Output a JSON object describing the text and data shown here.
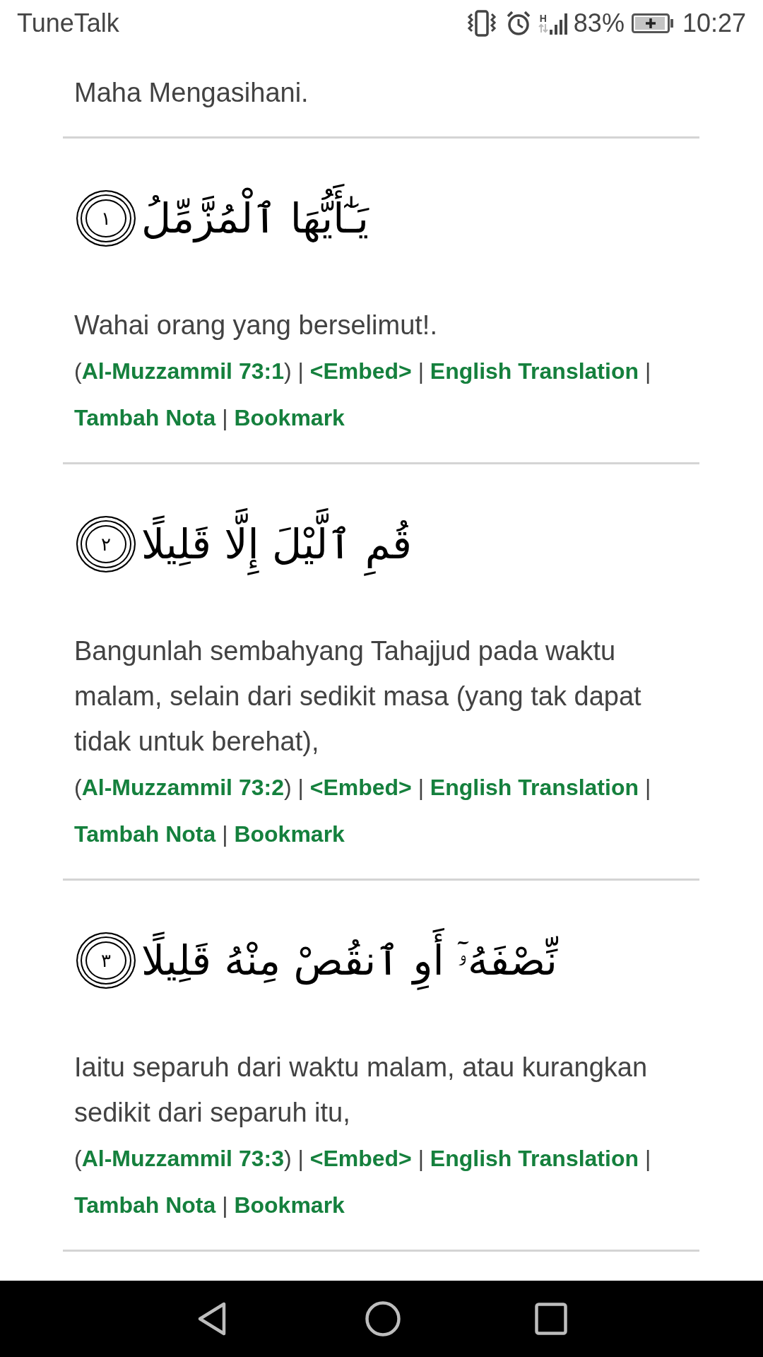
{
  "status_bar": {
    "carrier": "TuneTalk",
    "network_type": "H",
    "battery": "83%",
    "time": "10:27"
  },
  "intro": {
    "text": "Maha Mengasihani."
  },
  "verses": [
    {
      "arabic": "يَـٰٓأَيُّهَا ٱلْمُزَّمِّلُ",
      "number": "١",
      "translation": "Wahai orang yang berselimut!.",
      "reference_line": [
        {
          "kind": "open",
          "text": "("
        },
        {
          "kind": "link",
          "text": "Al-Muzzammil 73:1"
        },
        {
          "kind": "close",
          "text": ")"
        },
        {
          "kind": "separator",
          "text": "|"
        },
        {
          "kind": "link",
          "text": "<Embed>"
        },
        {
          "kind": "separator",
          "text": "|"
        },
        {
          "kind": "link",
          "text": "English Translation"
        },
        {
          "kind": "separator",
          "text": "|"
        },
        {
          "kind": "link",
          "text": "Tambah Nota"
        },
        {
          "kind": "separator",
          "text": "|"
        },
        {
          "kind": "link",
          "text": "Bookmark"
        }
      ]
    },
    {
      "arabic": "قُمِ ٱلَّيْلَ إِلَّا قَلِيلًا",
      "number": "٢",
      "translation": "Bangunlah sembahyang Tahajjud pada waktu malam, selain dari sedikit masa (yang tak dapat tidak untuk berehat),",
      "reference_line": [
        {
          "kind": "open",
          "text": "("
        },
        {
          "kind": "link",
          "text": "Al-Muzzammil 73:2"
        },
        {
          "kind": "close",
          "text": ")"
        },
        {
          "kind": "separator",
          "text": "|"
        },
        {
          "kind": "link",
          "text": "<Embed>"
        },
        {
          "kind": "separator",
          "text": "|"
        },
        {
          "kind": "link",
          "text": "English Translation"
        },
        {
          "kind": "separator",
          "text": "|"
        },
        {
          "kind": "link",
          "text": "Tambah Nota"
        },
        {
          "kind": "separator",
          "text": "|"
        },
        {
          "kind": "link",
          "text": "Bookmark"
        }
      ]
    },
    {
      "arabic": "نِّصْفَهُۥٓ أَوِ ٱنقُصْ مِنْهُ قَلِيلًا",
      "number": "٣",
      "translation": "Iaitu separuh dari waktu malam, atau kurangkan sedikit dari separuh itu,",
      "reference_line": [
        {
          "kind": "open",
          "text": "("
        },
        {
          "kind": "link",
          "text": "Al-Muzzammil 73:3"
        },
        {
          "kind": "close",
          "text": ")"
        },
        {
          "kind": "separator",
          "text": "|"
        },
        {
          "kind": "link",
          "text": "<Embed>"
        },
        {
          "kind": "separator",
          "text": "|"
        },
        {
          "kind": "link",
          "text": "English Translation"
        },
        {
          "kind": "separator",
          "text": "|"
        },
        {
          "kind": "link",
          "text": "Tambah Nota"
        },
        {
          "kind": "separator",
          "text": "|"
        },
        {
          "kind": "link",
          "text": "Bookmark"
        }
      ]
    }
  ]
}
